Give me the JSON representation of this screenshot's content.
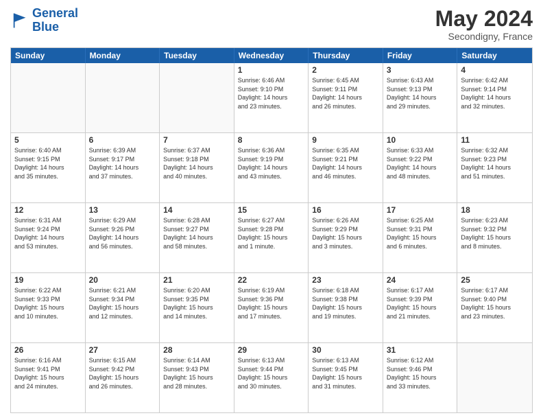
{
  "logo": {
    "line1": "General",
    "line2": "Blue"
  },
  "title": {
    "month_year": "May 2024",
    "location": "Secondigny, France"
  },
  "header": {
    "days": [
      "Sunday",
      "Monday",
      "Tuesday",
      "Wednesday",
      "Thursday",
      "Friday",
      "Saturday"
    ]
  },
  "weeks": [
    [
      {
        "day": "",
        "info": ""
      },
      {
        "day": "",
        "info": ""
      },
      {
        "day": "",
        "info": ""
      },
      {
        "day": "1",
        "info": "Sunrise: 6:46 AM\nSunset: 9:10 PM\nDaylight: 14 hours\nand 23 minutes."
      },
      {
        "day": "2",
        "info": "Sunrise: 6:45 AM\nSunset: 9:11 PM\nDaylight: 14 hours\nand 26 minutes."
      },
      {
        "day": "3",
        "info": "Sunrise: 6:43 AM\nSunset: 9:13 PM\nDaylight: 14 hours\nand 29 minutes."
      },
      {
        "day": "4",
        "info": "Sunrise: 6:42 AM\nSunset: 9:14 PM\nDaylight: 14 hours\nand 32 minutes."
      }
    ],
    [
      {
        "day": "5",
        "info": "Sunrise: 6:40 AM\nSunset: 9:15 PM\nDaylight: 14 hours\nand 35 minutes."
      },
      {
        "day": "6",
        "info": "Sunrise: 6:39 AM\nSunset: 9:17 PM\nDaylight: 14 hours\nand 37 minutes."
      },
      {
        "day": "7",
        "info": "Sunrise: 6:37 AM\nSunset: 9:18 PM\nDaylight: 14 hours\nand 40 minutes."
      },
      {
        "day": "8",
        "info": "Sunrise: 6:36 AM\nSunset: 9:19 PM\nDaylight: 14 hours\nand 43 minutes."
      },
      {
        "day": "9",
        "info": "Sunrise: 6:35 AM\nSunset: 9:21 PM\nDaylight: 14 hours\nand 46 minutes."
      },
      {
        "day": "10",
        "info": "Sunrise: 6:33 AM\nSunset: 9:22 PM\nDaylight: 14 hours\nand 48 minutes."
      },
      {
        "day": "11",
        "info": "Sunrise: 6:32 AM\nSunset: 9:23 PM\nDaylight: 14 hours\nand 51 minutes."
      }
    ],
    [
      {
        "day": "12",
        "info": "Sunrise: 6:31 AM\nSunset: 9:24 PM\nDaylight: 14 hours\nand 53 minutes."
      },
      {
        "day": "13",
        "info": "Sunrise: 6:29 AM\nSunset: 9:26 PM\nDaylight: 14 hours\nand 56 minutes."
      },
      {
        "day": "14",
        "info": "Sunrise: 6:28 AM\nSunset: 9:27 PM\nDaylight: 14 hours\nand 58 minutes."
      },
      {
        "day": "15",
        "info": "Sunrise: 6:27 AM\nSunset: 9:28 PM\nDaylight: 15 hours\nand 1 minute."
      },
      {
        "day": "16",
        "info": "Sunrise: 6:26 AM\nSunset: 9:29 PM\nDaylight: 15 hours\nand 3 minutes."
      },
      {
        "day": "17",
        "info": "Sunrise: 6:25 AM\nSunset: 9:31 PM\nDaylight: 15 hours\nand 6 minutes."
      },
      {
        "day": "18",
        "info": "Sunrise: 6:23 AM\nSunset: 9:32 PM\nDaylight: 15 hours\nand 8 minutes."
      }
    ],
    [
      {
        "day": "19",
        "info": "Sunrise: 6:22 AM\nSunset: 9:33 PM\nDaylight: 15 hours\nand 10 minutes."
      },
      {
        "day": "20",
        "info": "Sunrise: 6:21 AM\nSunset: 9:34 PM\nDaylight: 15 hours\nand 12 minutes."
      },
      {
        "day": "21",
        "info": "Sunrise: 6:20 AM\nSunset: 9:35 PM\nDaylight: 15 hours\nand 14 minutes."
      },
      {
        "day": "22",
        "info": "Sunrise: 6:19 AM\nSunset: 9:36 PM\nDaylight: 15 hours\nand 17 minutes."
      },
      {
        "day": "23",
        "info": "Sunrise: 6:18 AM\nSunset: 9:38 PM\nDaylight: 15 hours\nand 19 minutes."
      },
      {
        "day": "24",
        "info": "Sunrise: 6:17 AM\nSunset: 9:39 PM\nDaylight: 15 hours\nand 21 minutes."
      },
      {
        "day": "25",
        "info": "Sunrise: 6:17 AM\nSunset: 9:40 PM\nDaylight: 15 hours\nand 23 minutes."
      }
    ],
    [
      {
        "day": "26",
        "info": "Sunrise: 6:16 AM\nSunset: 9:41 PM\nDaylight: 15 hours\nand 24 minutes."
      },
      {
        "day": "27",
        "info": "Sunrise: 6:15 AM\nSunset: 9:42 PM\nDaylight: 15 hours\nand 26 minutes."
      },
      {
        "day": "28",
        "info": "Sunrise: 6:14 AM\nSunset: 9:43 PM\nDaylight: 15 hours\nand 28 minutes."
      },
      {
        "day": "29",
        "info": "Sunrise: 6:13 AM\nSunset: 9:44 PM\nDaylight: 15 hours\nand 30 minutes."
      },
      {
        "day": "30",
        "info": "Sunrise: 6:13 AM\nSunset: 9:45 PM\nDaylight: 15 hours\nand 31 minutes."
      },
      {
        "day": "31",
        "info": "Sunrise: 6:12 AM\nSunset: 9:46 PM\nDaylight: 15 hours\nand 33 minutes."
      },
      {
        "day": "",
        "info": ""
      }
    ]
  ]
}
